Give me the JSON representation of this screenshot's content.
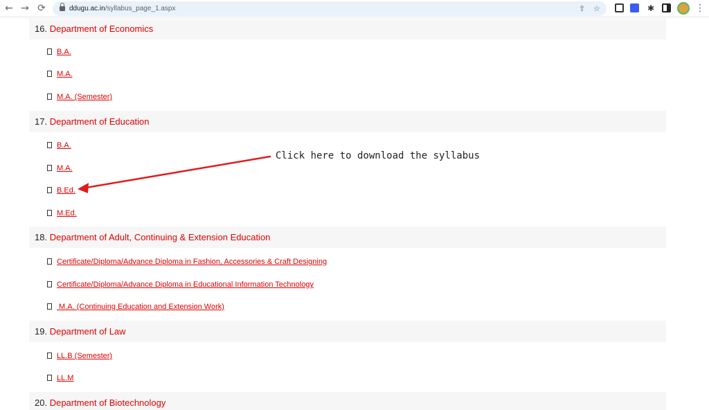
{
  "browser": {
    "url_host": "ddugu.ac.in",
    "url_path": "/syllabus_page_1.aspx"
  },
  "sections": [
    {
      "num": "16.",
      "name": "Department of Economics",
      "items": [
        "B.A.",
        "M.A.",
        "M.A. (Semester)"
      ]
    },
    {
      "num": "17.",
      "name": "Department of Education",
      "items": [
        "B.A.",
        "M.A.",
        "B.Ed.",
        "M.Ed."
      ]
    },
    {
      "num": "18.",
      "name": "Department of Adult, Continuing & Extension Education",
      "items": [
        "Certificate/Diploma/Advance Diploma in Fashion, Accessories & Craft Designing",
        "Certificate/Diploma/Advance Diploma in Educational Information Technology",
        " M.A. (Continuing Education and Extension Work)"
      ]
    },
    {
      "num": "19.",
      "name": "Department of Law",
      "items": [
        "LL.B (Semester)",
        "LL.M"
      ]
    },
    {
      "num": "20.",
      "name": "Department of Biotechnology",
      "items": []
    }
  ],
  "annotation": {
    "text": "Click here to download the syllabus",
    "color": "#e21a1a"
  }
}
